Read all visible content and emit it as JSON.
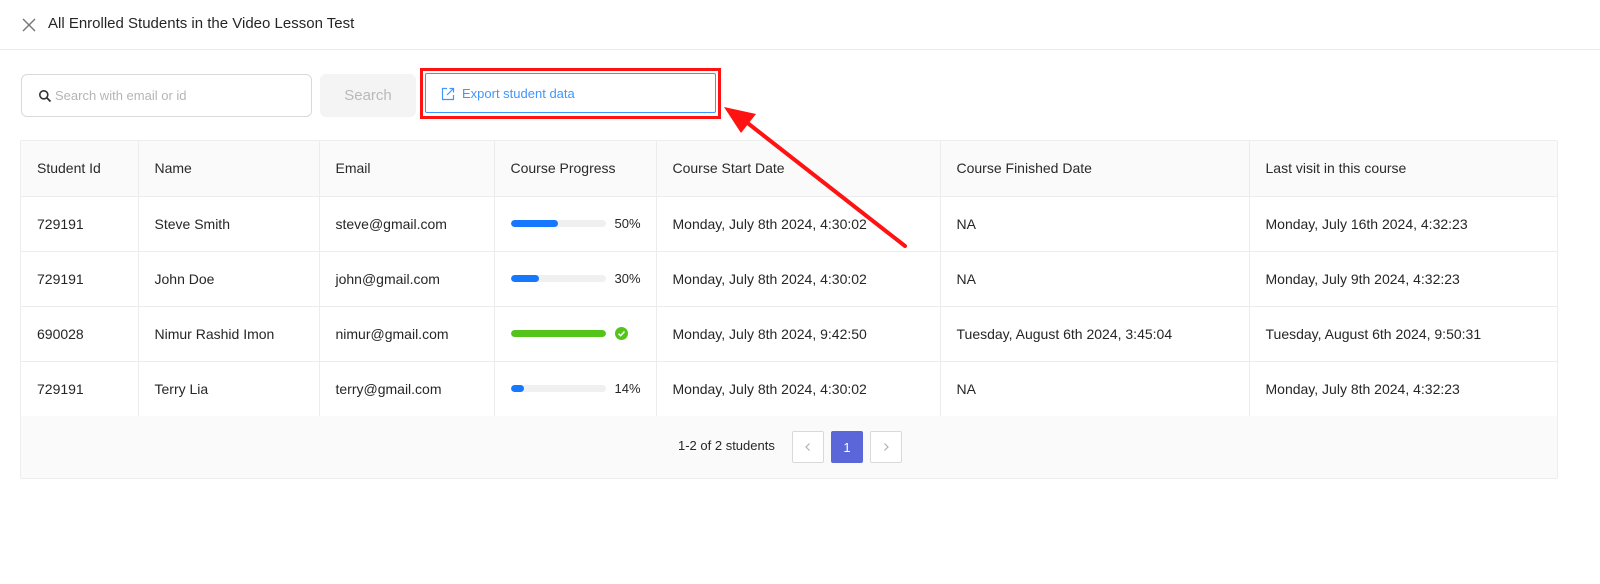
{
  "header": {
    "title": "All Enrolled Students in the Video Lesson Test",
    "close_icon": "close-icon"
  },
  "toolbar": {
    "search_placeholder": "Search with email or id",
    "search_value": "",
    "search_button": "Search",
    "export_button": "Export student data",
    "export_icon": "export-icon"
  },
  "table": {
    "columns": [
      "Student Id",
      "Name",
      "Email",
      "Course Progress",
      "Course Start Date",
      "Course Finished Date",
      "Last visit in this course"
    ],
    "rows": [
      {
        "id": "729191",
        "name": "Steve Smith",
        "email": "steve@gmail.com",
        "progress": 50,
        "progress_label": "50%",
        "completed": false,
        "start": "Monday, July 8th 2024, 4:30:02",
        "finished": "NA",
        "last_visit": "Monday, July 16th 2024, 4:32:23"
      },
      {
        "id": "729191",
        "name": "John Doe",
        "email": "john@gmail.com",
        "progress": 30,
        "progress_label": "30%",
        "completed": false,
        "start": "Monday, July 8th 2024, 4:30:02",
        "finished": "NA",
        "last_visit": "Monday, July 9th 2024, 4:32:23"
      },
      {
        "id": "690028",
        "name": "Nimur Rashid Imon",
        "email": "nimur@gmail.com",
        "progress": 100,
        "progress_label": "",
        "completed": true,
        "start": "Monday, July 8th 2024, 9:42:50",
        "finished": "Tuesday, August 6th 2024, 3:45:04",
        "last_visit": "Tuesday, August 6th 2024, 9:50:31"
      },
      {
        "id": "729191",
        "name": "Terry Lia",
        "email": "terry@gmail.com",
        "progress": 14,
        "progress_label": "14%",
        "completed": false,
        "start": "Monday, July 8th 2024, 4:30:02",
        "finished": "NA",
        "last_visit": "Monday, July 8th 2024, 4:32:23"
      }
    ]
  },
  "pagination": {
    "info": "1-2 of 2 students",
    "current_page": "1",
    "prev": "<",
    "next": ">"
  },
  "colors": {
    "progress_active": "#1677ff",
    "progress_done": "#52c41a",
    "annotation": "#ff1212",
    "page_active": "#5b67d9",
    "export_blue": "#4096ff"
  }
}
